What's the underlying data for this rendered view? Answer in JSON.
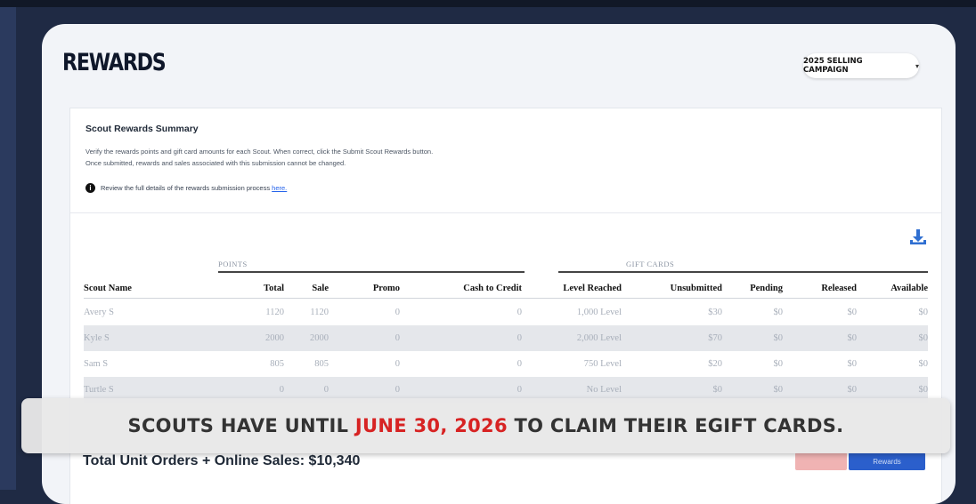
{
  "page": {
    "title": "REWARDS"
  },
  "campaign": {
    "label": "2025 SELLING CAMPAIGN"
  },
  "summary": {
    "title": "Scout Rewards Summary",
    "line1": "Verify the rewards points and gift card amounts for each Scout. When correct, click the Submit Scout Rewards button.",
    "line2": "Once submitted, rewards and sales associated with this submission cannot be changed.",
    "note_text": "Review the full details of the rewards submission process ",
    "note_link": "here."
  },
  "table": {
    "groups": {
      "points": "POINTS",
      "gift_cards": "GIFT CARDS"
    },
    "headers": [
      "Scout Name",
      "Total",
      "Sale",
      "Promo",
      "Cash to Credit",
      "Level Reached",
      "Unsubmitted",
      "Pending",
      "Released",
      "Available"
    ],
    "rows": [
      [
        "Avery S",
        "1120",
        "1120",
        "0",
        "0",
        "1,000 Level",
        "$30",
        "$0",
        "$0",
        "$0"
      ],
      [
        "Kyle S",
        "2000",
        "2000",
        "0",
        "0",
        "2,000 Level",
        "$70",
        "$0",
        "$0",
        "$0"
      ],
      [
        "Sam S",
        "805",
        "805",
        "0",
        "0",
        "750 Level",
        "$20",
        "$0",
        "$0",
        "$0"
      ],
      [
        "Turtle S",
        "0",
        "0",
        "0",
        "0",
        "No Level",
        "$0",
        "$0",
        "$0",
        "$0"
      ]
    ]
  },
  "footer": {
    "total_line": "Total Unit Orders + Online Sales: $10,340",
    "submit_label": "Rewards"
  },
  "banner": {
    "pre": "SCOUTS HAVE UNTIL ",
    "highlight": "JUNE 30, 2026",
    "post": " TO CLAIM THEIR EGIFT CARDS."
  },
  "colors": {
    "accent_blue": "#2b5fcc",
    "banner_highlight": "#d72323",
    "download_icon": "#2f6fd1"
  },
  "icons": {
    "info": "info-icon",
    "download": "download-icon",
    "chevron": "chevron-down-icon"
  }
}
